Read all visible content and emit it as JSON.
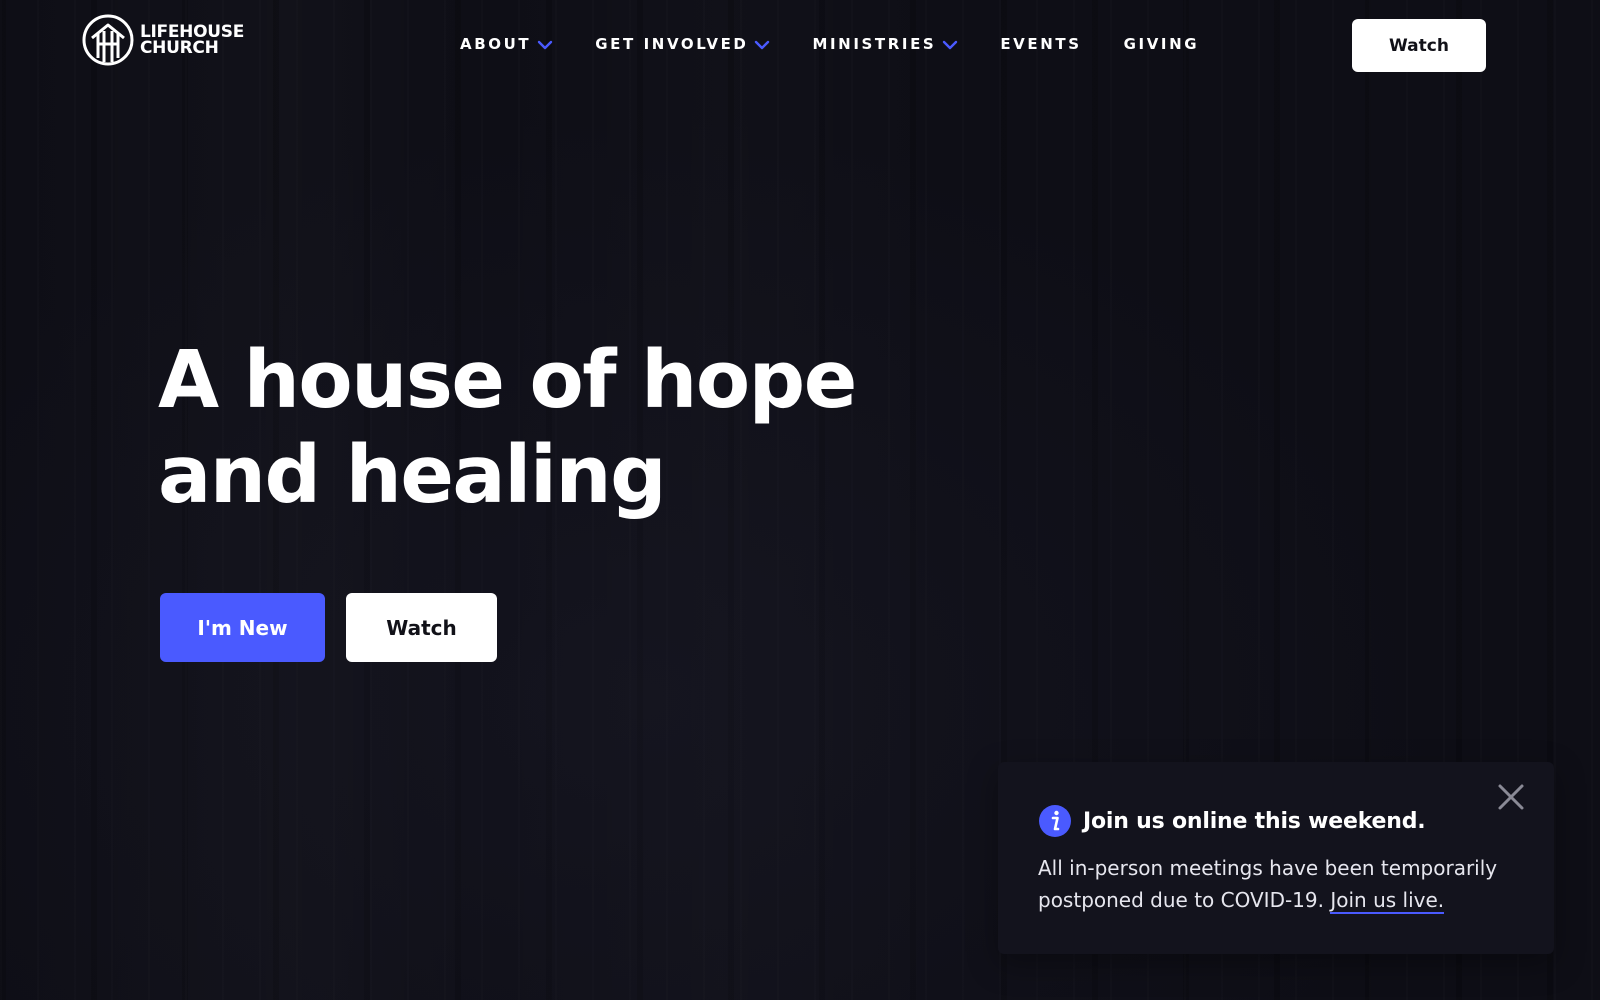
{
  "brand": {
    "line1": "LIFEHOUSE",
    "line2": "CHURCH"
  },
  "nav": {
    "items": [
      {
        "label": "ABOUT",
        "has_dropdown": true
      },
      {
        "label": "GET INVOLVED",
        "has_dropdown": true
      },
      {
        "label": "MINISTRIES",
        "has_dropdown": true
      },
      {
        "label": "EVENTS",
        "has_dropdown": false
      },
      {
        "label": "GIVING",
        "has_dropdown": false
      }
    ],
    "watch_label": "Watch"
  },
  "hero": {
    "title_line1": "A house of hope",
    "title_line2": "and healing",
    "primary_button": "I'm New",
    "secondary_button": "Watch"
  },
  "notice": {
    "title": "Join us online this weekend.",
    "body": "All in-person meetings have been temporarily postponed due to COVID-19.",
    "link_text": "Join us live."
  },
  "colors": {
    "background": "#0e0e16",
    "accent": "#4a5aff",
    "card": "#13131d",
    "text": "#ffffff"
  },
  "icons": {
    "logo": "house-circle-logo-icon",
    "dropdown": "chevron-down-icon",
    "info": "info-icon",
    "close": "close-icon"
  }
}
